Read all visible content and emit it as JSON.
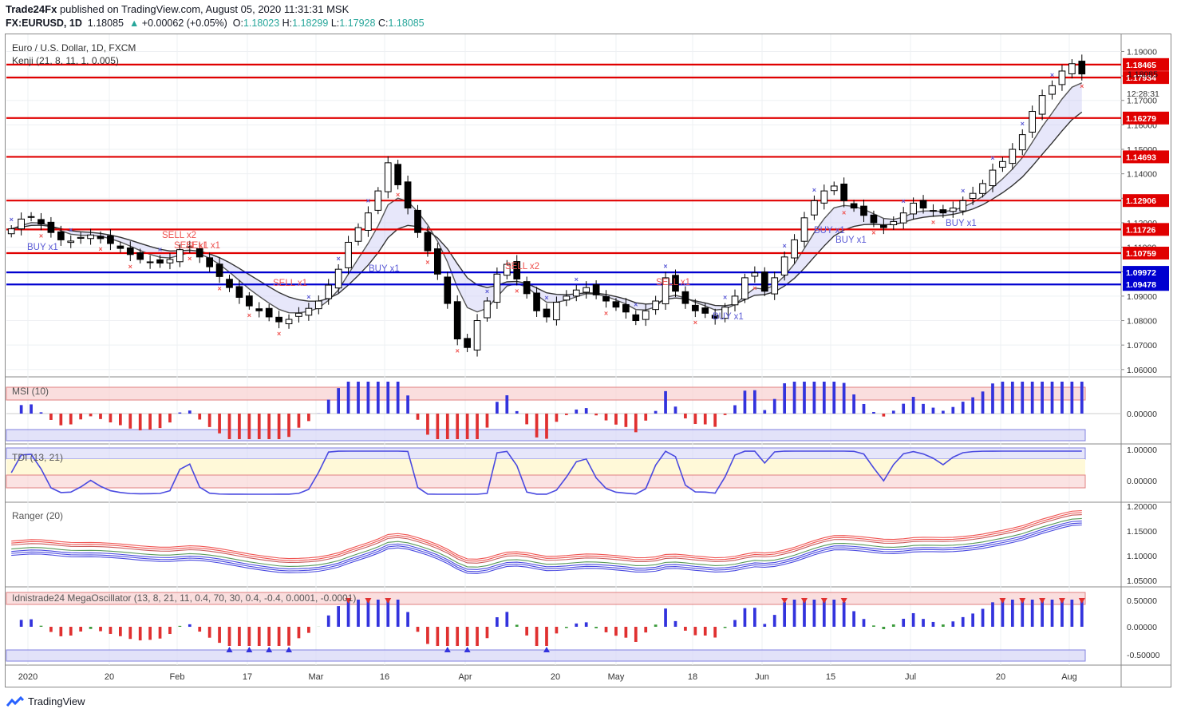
{
  "header": {
    "publisher": "Trade24Fx",
    "published_text": "published on TradingView.com, August 05, 2020 11:31:31 MSK",
    "symbol": "FX:EURUSD, 1D",
    "last": "1.18085",
    "change": "+0.00062 (+0.05%)",
    "o_label": "O:",
    "o": "1.18023",
    "h_label": "H:",
    "h": "1.18299",
    "l_label": "L:",
    "l": "1.17928",
    "c_label": "C:",
    "c": "1.18085"
  },
  "main_pane": {
    "title": "Euro / U.S. Dollar, 1D, FXCM",
    "indicator": "Kenji (21, 8, 11, 1, 0.005)",
    "countdown": "12:28:31"
  },
  "panes": {
    "msi": "MSI (10)",
    "tdi": "TDI (13, 21)",
    "ranger": "Ranger (20)",
    "mega": "Idnistrade24 MegaOscillator (13, 8, 21, 11, 0.4, 70, 30, 0.4, -0.4, 0.0001, -0.0001)"
  },
  "footer": {
    "brand": "TradingView"
  },
  "colors": {
    "bull": "#ffffff",
    "bear": "#000000",
    "level_red": "#e00000",
    "level_blue": "#0000d0",
    "buy": "#5b5bd6",
    "sell": "#ef5350"
  },
  "chart_data": [
    {
      "type": "candlestick",
      "title": "Euro / U.S. Dollar, 1D, FXCM",
      "x_ticks": [
        "2020",
        "20",
        "Feb",
        "17",
        "Mar",
        "16",
        "Apr",
        "20",
        "May",
        "18",
        "Jun",
        "15",
        "Jul",
        "20",
        "Aug"
      ],
      "y_ticks": [
        "1.19000",
        "1.18000",
        "1.17000",
        "1.16000",
        "1.15000",
        "1.14000",
        "1.13000",
        "1.12000",
        "1.11000",
        "1.10000",
        "1.09000",
        "1.08000",
        "1.07000",
        "1.06000"
      ],
      "ylim": [
        1.057,
        1.197
      ],
      "current_price_label": "1.18085",
      "horizontal_levels": [
        {
          "value": 1.18465,
          "label": "1.18465",
          "color": "#e00000"
        },
        {
          "value": 1.17934,
          "label": "1.17934",
          "color": "#e00000"
        },
        {
          "value": 1.16279,
          "label": "1.16279",
          "color": "#e00000"
        },
        {
          "value": 1.14693,
          "label": "1.14693",
          "color": "#e00000"
        },
        {
          "value": 1.12906,
          "label": "1.12906",
          "color": "#e00000"
        },
        {
          "value": 1.11726,
          "label": "1.11726",
          "color": "#e00000"
        },
        {
          "value": 1.10759,
          "label": "1.10759",
          "color": "#e00000"
        },
        {
          "value": 1.09972,
          "label": "1.09972",
          "color": "#0000d0"
        },
        {
          "value": 1.09478,
          "label": "1.09478",
          "color": "#0000d0"
        }
      ],
      "close_path": [
        1.1175,
        1.1215,
        1.1225,
        1.1195,
        1.116,
        1.113,
        1.1125,
        1.114,
        1.115,
        1.1135,
        1.1115,
        1.1095,
        1.107,
        1.105,
        1.104,
        1.1035,
        1.105,
        1.109,
        1.11,
        1.106,
        1.102,
        1.098,
        1.0935,
        1.0895,
        1.086,
        1.084,
        1.0815,
        1.0795,
        1.0805,
        1.083,
        1.085,
        1.088,
        1.0945,
        1.101,
        1.112,
        1.118,
        1.124,
        1.133,
        1.1445,
        1.1355,
        1.126,
        1.116,
        1.1085,
        1.099,
        1.087,
        1.0725,
        1.069,
        1.08,
        1.088,
        1.099,
        1.103,
        1.097,
        1.091,
        1.084,
        1.0815,
        1.0875,
        1.09,
        1.0925,
        1.0935,
        1.0905,
        1.088,
        1.0855,
        1.0835,
        1.08,
        1.084,
        1.088,
        1.0975,
        1.092,
        1.087,
        1.084,
        1.083,
        1.081,
        1.0855,
        1.09,
        1.0975,
        1.0995,
        1.092,
        1.0975,
        1.106,
        1.113,
        1.122,
        1.129,
        1.133,
        1.135,
        1.129,
        1.126,
        1.123,
        1.12,
        1.118,
        1.1205,
        1.124,
        1.128,
        1.126,
        1.125,
        1.124,
        1.126,
        1.129,
        1.132,
        1.136,
        1.1415,
        1.145,
        1.15,
        1.156,
        1.1655,
        1.172,
        1.176,
        1.182,
        1.185,
        1.1808
      ]
    },
    {
      "type": "bar",
      "title": "MSI (10)",
      "y_ticks": [
        "0.00000"
      ],
      "series": [
        {
          "name": "MSI",
          "sign_profile": "oscillating"
        }
      ]
    },
    {
      "type": "line",
      "title": "TDI (13, 21)",
      "y_ticks": [
        "1.00000",
        "0.00000"
      ]
    },
    {
      "type": "line",
      "title": "Ranger (20)",
      "y_ticks": [
        "1.20000",
        "1.15000",
        "1.10000",
        "1.05000"
      ]
    },
    {
      "type": "bar",
      "title": "Idnistrade24 MegaOscillator (13, 8, 21, 11, 0.4, 70, 30, 0.4, -0.4, 0.0001, -0.0001)",
      "y_ticks": [
        "0.50000",
        "0.00000",
        "-0.50000"
      ]
    }
  ],
  "annotations": {
    "buy": [
      "BUY x1",
      "BUY x1",
      "BUY x1",
      "BUY x1",
      "BUY x1",
      "BUY x1"
    ],
    "sell": [
      "SELL x2",
      "SELL x1",
      "SELL x1",
      "SELL x1",
      "SELL x2",
      "SELL x1"
    ]
  }
}
